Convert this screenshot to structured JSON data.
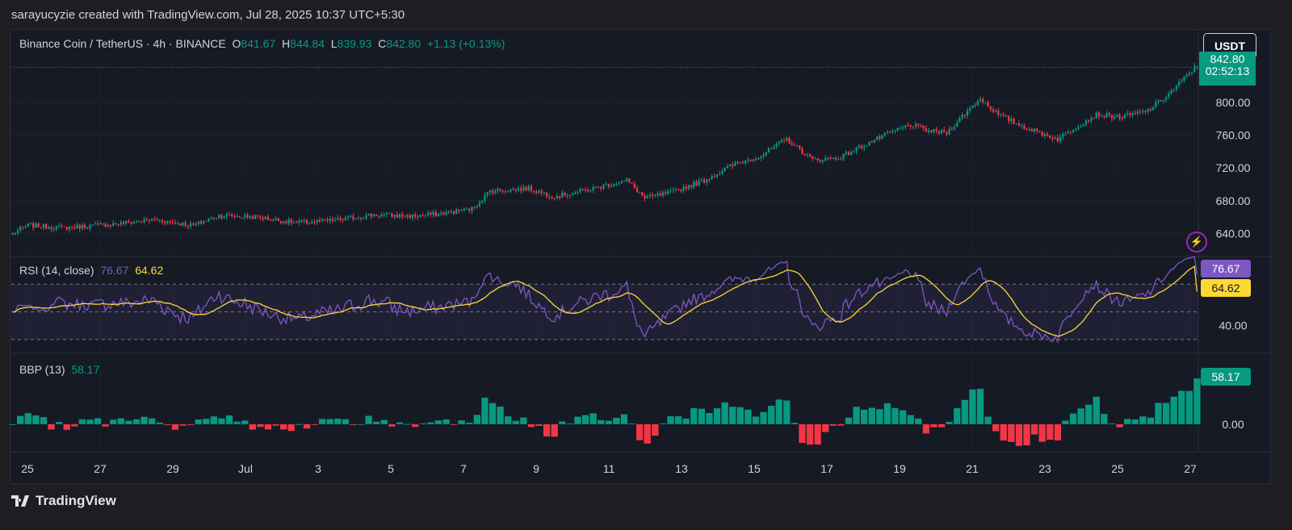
{
  "credit": "sarayucyzie created with TradingView.com, Jul 28, 2025 10:37 UTC+5:30",
  "legend": {
    "symbol": "Binance Coin / TetherUS · 4h · BINANCE",
    "o_label": "O",
    "o": "841.67",
    "h_label": "H",
    "h": "844.84",
    "l_label": "L",
    "l": "839.93",
    "c_label": "C",
    "c": "842.80",
    "change": "+1.13 (+0.13%)"
  },
  "currency_button": "USDT",
  "price_tag": {
    "price": "842.80",
    "countdown": "02:52:13"
  },
  "rsi_legend": {
    "label": "RSI (14, close)",
    "rsi": "76.67",
    "ma": "64.62"
  },
  "bbp_legend": {
    "label": "BBP (13)",
    "value": "58.17"
  },
  "brand": "TradingView",
  "colors": {
    "up": "#089981",
    "down": "#f23645",
    "rsi": "#7e57c2",
    "rsi_ma": "#fdd835",
    "grid": "#2a2e39"
  },
  "chart_data": [
    {
      "type": "candlestick",
      "title": "Binance Coin / TetherUS · 4h · BINANCE",
      "ylim": [
        612,
        852
      ],
      "yticks": [
        "640.00",
        "680.00",
        "720.00",
        "760.00",
        "800.00"
      ],
      "xticks": [
        "25",
        "27",
        "29",
        "Jul",
        "3",
        "5",
        "7",
        "9",
        "11",
        "13",
        "15",
        "17",
        "19",
        "21",
        "23",
        "25",
        "27"
      ],
      "close_anchors": [
        [
          0,
          640
        ],
        [
          6,
          650
        ],
        [
          20,
          647
        ],
        [
          40,
          652
        ],
        [
          55,
          657
        ],
        [
          70,
          650
        ],
        [
          80,
          662
        ],
        [
          95,
          660
        ],
        [
          110,
          653
        ],
        [
          125,
          656
        ],
        [
          140,
          663
        ],
        [
          155,
          661
        ],
        [
          165,
          664
        ],
        [
          178,
          670
        ],
        [
          185,
          692
        ],
        [
          200,
          695
        ],
        [
          210,
          685
        ],
        [
          225,
          695
        ],
        [
          238,
          705
        ],
        [
          245,
          683
        ],
        [
          255,
          690
        ],
        [
          268,
          705
        ],
        [
          280,
          725
        ],
        [
          290,
          735
        ],
        [
          300,
          755
        ],
        [
          310,
          730
        ],
        [
          320,
          732
        ],
        [
          330,
          748
        ],
        [
          338,
          760
        ],
        [
          348,
          773
        ],
        [
          355,
          765
        ],
        [
          362,
          763
        ],
        [
          368,
          783
        ],
        [
          375,
          805
        ],
        [
          382,
          785
        ],
        [
          392,
          770
        ],
        [
          405,
          755
        ],
        [
          412,
          770
        ],
        [
          420,
          785
        ],
        [
          430,
          782
        ],
        [
          440,
          790
        ],
        [
          448,
          810
        ],
        [
          458,
          842
        ]
      ],
      "last": {
        "open": 841.67,
        "high": 844.84,
        "low": 839.93,
        "close": 842.8
      }
    },
    {
      "type": "line",
      "title": "RSI (14, close)",
      "ylim": [
        20,
        90
      ],
      "yticks": [
        "40.00"
      ],
      "bands": {
        "upper": 70,
        "middle": 50,
        "lower": 30
      },
      "series": [
        {
          "name": "RSI",
          "last": 76.67
        },
        {
          "name": "RSI-based MA",
          "last": 64.62
        }
      ]
    },
    {
      "type": "bar",
      "title": "BBP (13)",
      "ylim": [
        -35,
        90
      ],
      "yticks": [
        "0.00"
      ],
      "last": 58.17
    }
  ]
}
